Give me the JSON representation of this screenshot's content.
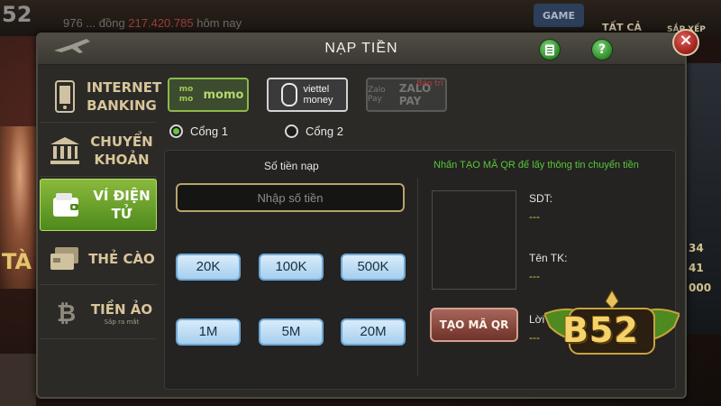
{
  "background": {
    "logo": "52",
    "ticker_amount": "217.420.785",
    "ticker_suffix": "hôm nay",
    "ticker_prefix": "976 ... đồng",
    "game_tag": "GAME",
    "tab_all": "TẤT CẢ",
    "tab_sort": "SẮP XẾP",
    "left_promo": "TÀ",
    "right_numbers": [
      "34",
      "41",
      "000"
    ]
  },
  "modal": {
    "title": "NẠP TIỀN",
    "note_icon": "document-icon",
    "help_label": "?",
    "close_label": "×"
  },
  "sidebar": {
    "items": [
      {
        "label": "INTERNET BANKING",
        "icon": "phone-icon",
        "active": false
      },
      {
        "label": "CHUYỂN KHOẢN",
        "icon": "bank-icon",
        "active": false
      },
      {
        "label": "VÍ ĐIỆN TỬ",
        "icon": "wallet-icon",
        "active": true
      },
      {
        "label": "THẺ CÀO",
        "icon": "card-icon",
        "active": false
      },
      {
        "label": "TIỀN ẢO",
        "sub": "Sắp ra mắt",
        "icon": "bitcoin-icon",
        "active": false
      }
    ]
  },
  "wallets": {
    "momo": {
      "mark": "mo mo",
      "label": "momo"
    },
    "viettel": {
      "line1": "viettel",
      "line2": "money"
    },
    "zalo": {
      "mark": "Zalo Pay",
      "label": "ZALO PAY",
      "badge": "Bảo trì"
    }
  },
  "gates": [
    {
      "label": "Cổng 1",
      "selected": true
    },
    {
      "label": "Cổng 2",
      "selected": false
    }
  ],
  "form": {
    "amount_label": "Số tiền nạp",
    "amount_placeholder": "Nhập số tiền",
    "amount_value": "",
    "presets": [
      "20K",
      "100K",
      "500K",
      "1M",
      "5M",
      "20M"
    ],
    "qr_hint": "Nhấn TẠO MÃ QR để lấy thông tin chuyển tiền",
    "qr_button": "TẠO MÃ QR",
    "fields": [
      {
        "label": "SDT:",
        "value": "---"
      },
      {
        "label": "Tên TK:",
        "value": "---"
      },
      {
        "label": "Lời",
        "value": "---"
      }
    ]
  },
  "brand": {
    "text": "B52"
  },
  "colors": {
    "accent_green": "#68c343",
    "hint_green": "#58c63a",
    "value_yellow": "#e2c14a",
    "close_red": "#c2322b"
  }
}
